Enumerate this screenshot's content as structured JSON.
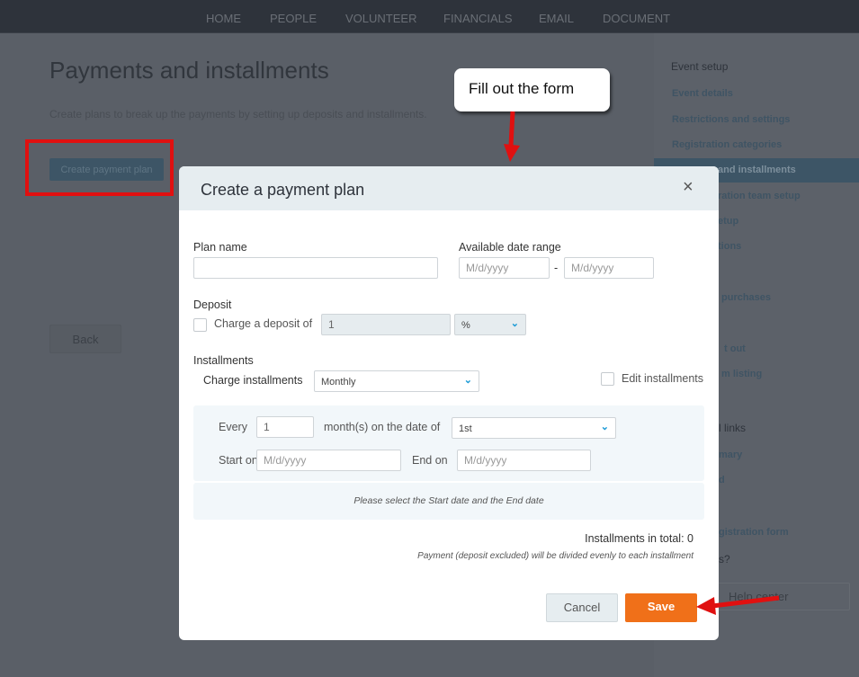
{
  "nav": {
    "items": [
      "HOME",
      "PEOPLE",
      "VOLUNTEER",
      "FINANCIALS",
      "EMAIL",
      "DOCUMENT"
    ]
  },
  "page": {
    "title": "Payments and installments",
    "description": "Create plans to break up the payments by setting up deposits and installments.",
    "create_button": "Create payment plan",
    "back_button": "Back"
  },
  "sidebar": {
    "heading1": "Event setup",
    "links": [
      "Event details",
      "Restrictions and settings",
      "Registration categories",
      "and installments",
      "ration team setup",
      "etup",
      "tions",
      "purchases",
      "t out",
      "m listing"
    ],
    "heading2": "l links",
    "links2": [
      "mary",
      "d",
      "gistration form"
    ],
    "heading3": "s?",
    "help_button": "Help center"
  },
  "callout": {
    "text": "Fill out the form"
  },
  "modal": {
    "title": "Create a payment plan",
    "close": "×",
    "plan_name_label": "Plan name",
    "plan_name_value": "",
    "date_range_label": "Available date range",
    "date_placeholder": "M/d/yyyy",
    "date_sep": "-",
    "deposit_label": "Deposit",
    "charge_deposit_label": "Charge a deposit of",
    "deposit_value": "1",
    "deposit_unit": "%",
    "installments_label": "Installments",
    "charge_installments_label": "Charge installments",
    "frequency": "Monthly",
    "edit_installments_label": "Edit installments",
    "every_label": "Every",
    "every_value": "1",
    "months_label": "month(s) on the date of",
    "date_of": "1st",
    "start_label": "Start on",
    "end_label": "End on",
    "hint": "Please select the Start date and the End date",
    "total": "Installments in total: 0",
    "note": "Payment (deposit excluded) will be divided evenly to each installment",
    "cancel": "Cancel",
    "save": "Save"
  },
  "colors": {
    "accent": "#f07019",
    "annotation": "#e01010"
  }
}
